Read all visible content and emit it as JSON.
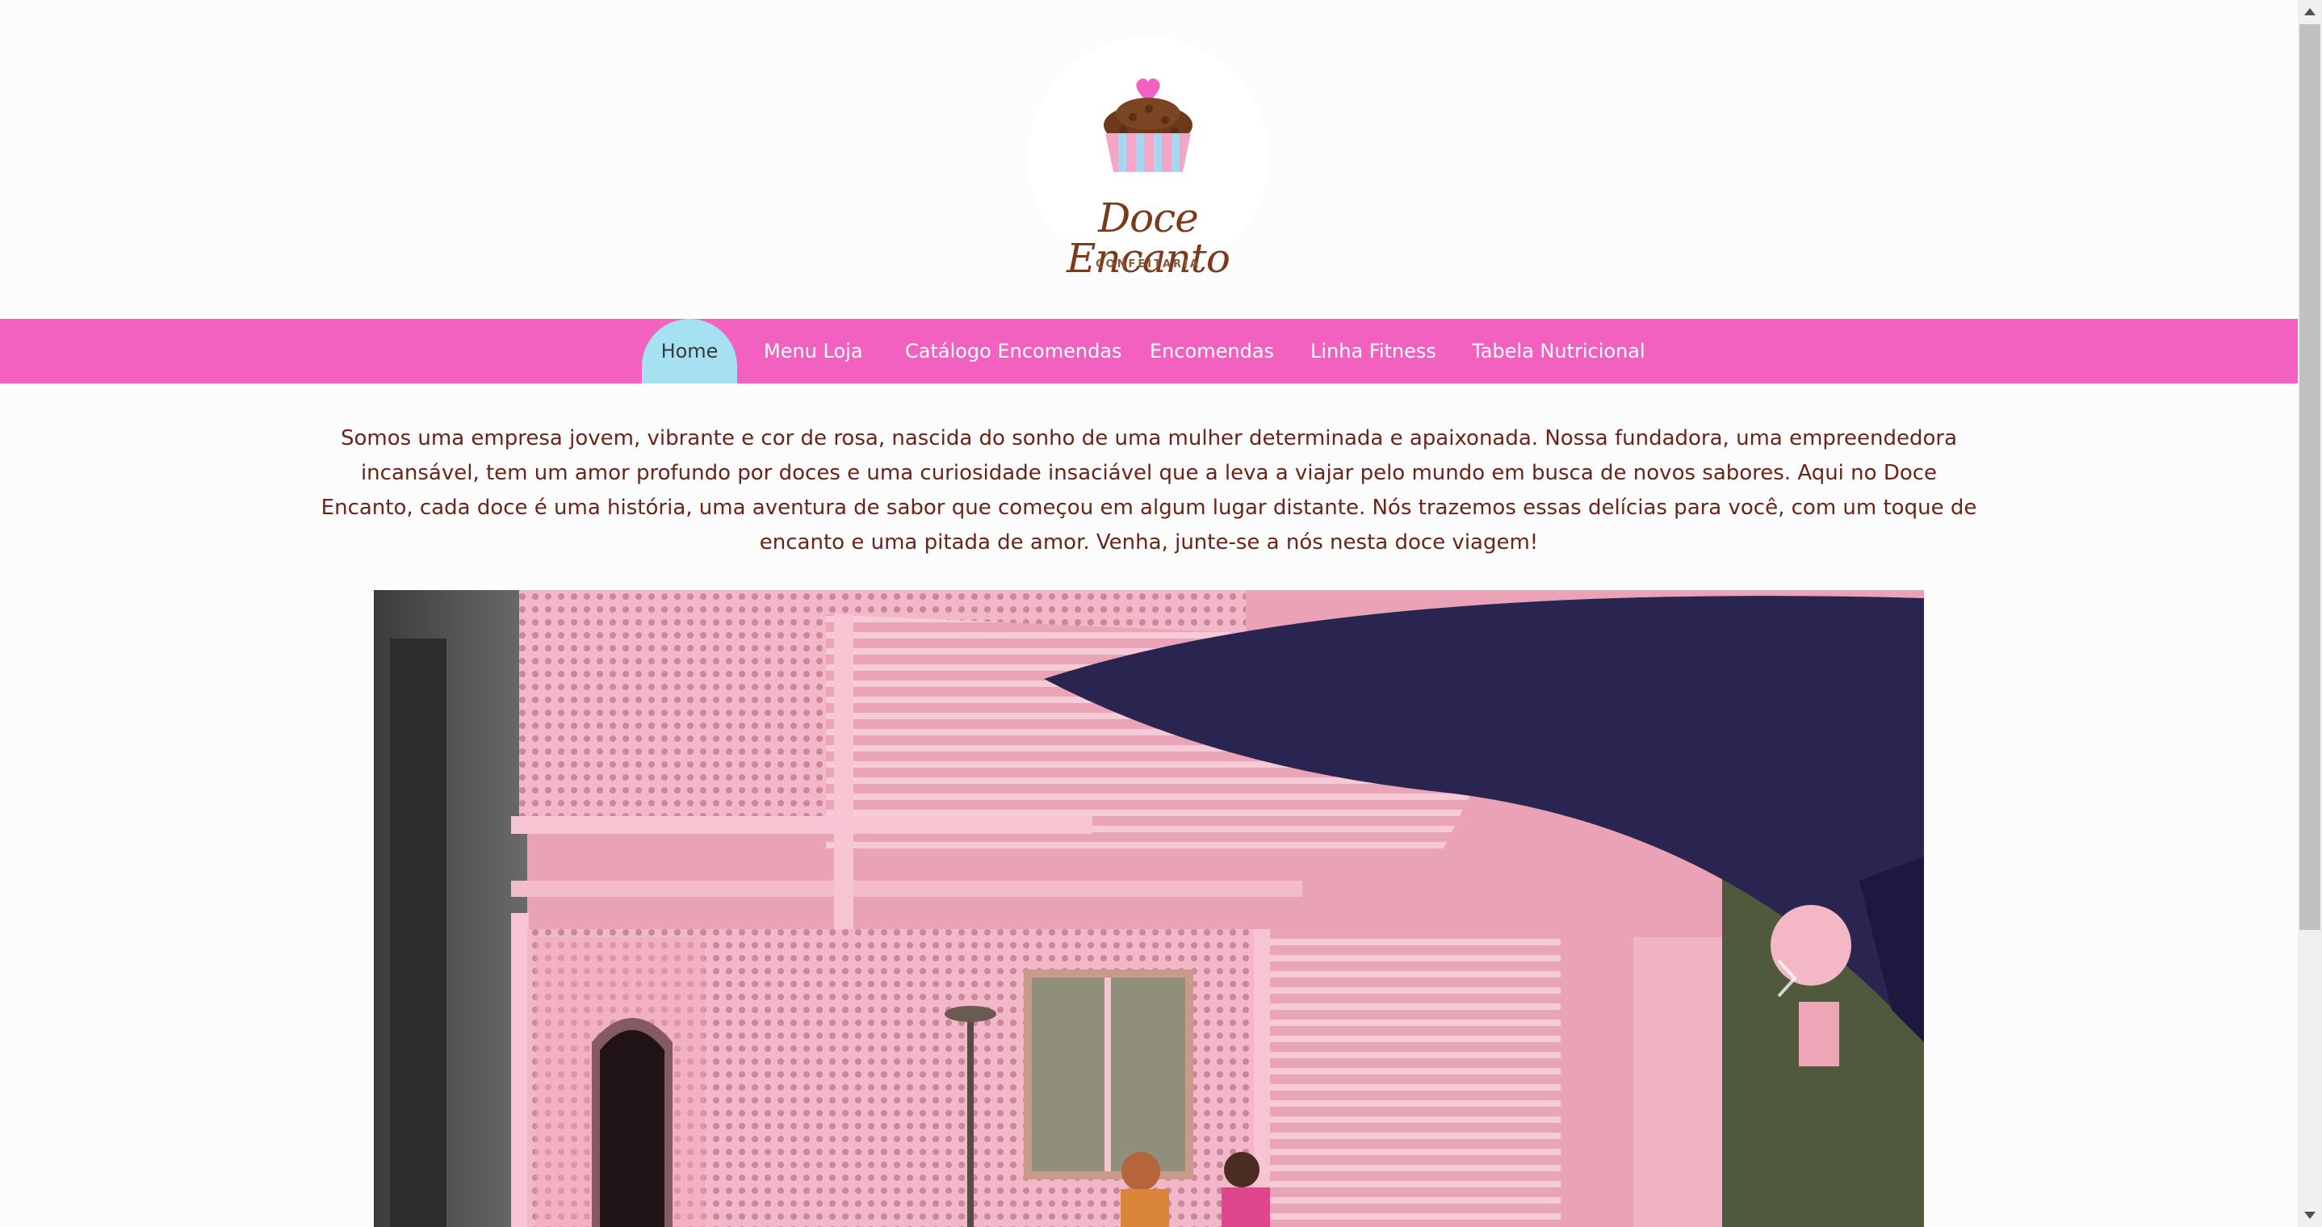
{
  "logo": {
    "name": "Doce Encanto",
    "subtitle": "CONFEITARIA",
    "colors": {
      "heart": "#f261bf",
      "chocolate": "#6b3a1c",
      "stripe_pink": "#f4a6c6",
      "stripe_blue": "#a6d6f0"
    }
  },
  "nav": {
    "items": [
      {
        "label": "Home",
        "active": true
      },
      {
        "label": "Menu Loja",
        "active": false
      },
      {
        "label": "Catálogo Encomendas",
        "active": false
      },
      {
        "label": "Encomendas",
        "active": false
      },
      {
        "label": "Linha Fitness",
        "active": false
      },
      {
        "label": "Tabela Nutricional",
        "active": false
      }
    ],
    "colors": {
      "background": "#f261bf",
      "active": "#a6e1f1"
    }
  },
  "intro": {
    "text": "Somos uma empresa jovem, vibrante e cor de rosa, nascida do sonho de uma mulher determinada e apaixonada. Nossa fundadora, uma empreendedora incansável, tem um amor profundo por doces e uma curiosidade insaciável que a leva a viajar pelo mundo em busca de novos sabores. Aqui no Doce Encanto, cada doce é uma história, uma aventura de sabor que começou em algum lugar distante. Nós trazemos essas delícias para você, com um toque de encanto e uma pitada de amor. Venha, junte-se a nós nesta doce viagem!"
  },
  "hero": {
    "icon_next": "chevron-right-icon"
  }
}
